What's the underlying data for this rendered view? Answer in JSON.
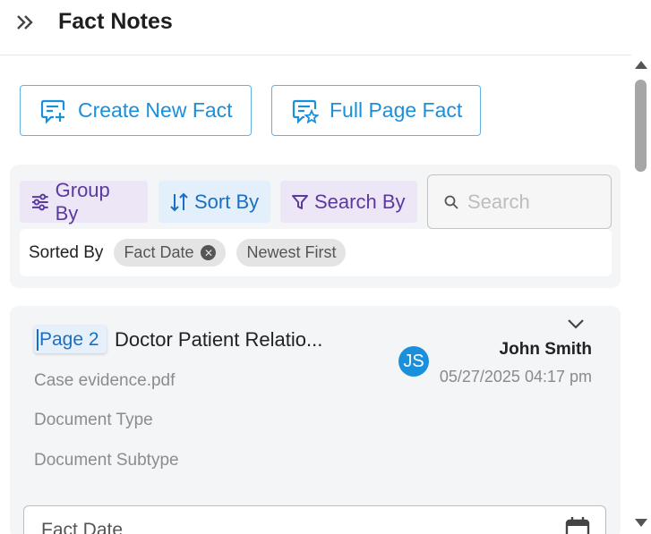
{
  "header": {
    "title": "Fact Notes",
    "collapse_icon": "double-chevron-right-icon"
  },
  "actions": {
    "create_label": "Create New Fact",
    "full_page_label": "Full Page Fact"
  },
  "filters": {
    "group_by_label": "Group By",
    "sort_by_label": "Sort By",
    "search_by_label": "Search By",
    "search_placeholder": "Search",
    "sorted_by_label": "Sorted By",
    "sort_tags": [
      "Fact Date",
      "Newest First"
    ]
  },
  "fact_card": {
    "page_label": "Page 2",
    "title": "Doctor Patient Relatio...",
    "author_initials": "JS",
    "author_name": "John Smith",
    "timestamp": "05/27/2025 04:17 pm",
    "file_name": "Case evidence.pdf",
    "document_type_label": "Document Type",
    "document_subtype_label": "Document Subtype",
    "fact_date_label": "Fact Date"
  },
  "colors": {
    "accent_blue": "#1a8fdb",
    "purple_chip": "#ece6f7",
    "blue_chip": "#e3effa"
  }
}
